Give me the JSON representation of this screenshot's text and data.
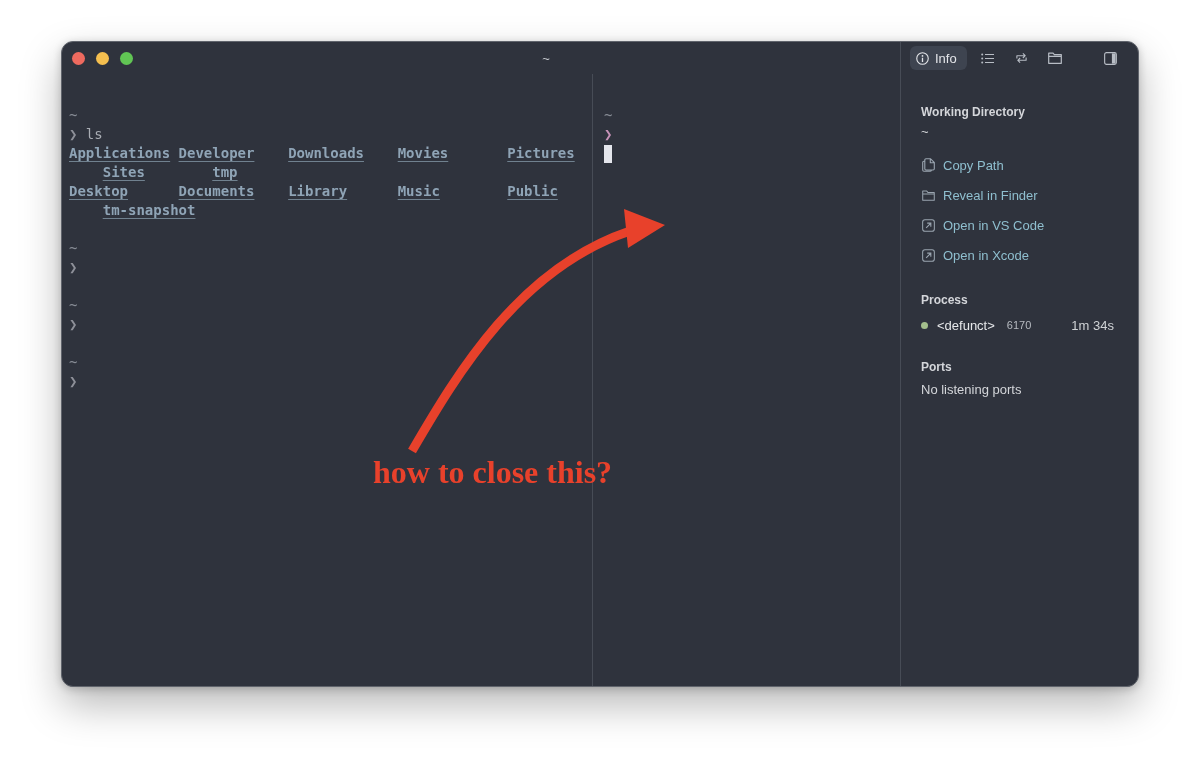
{
  "window": {
    "title": "~"
  },
  "terminal": {
    "panes": [
      {
        "focused": false,
        "blocks": [
          {
            "cwd": "~",
            "prompt": "❯",
            "command": "ls",
            "output": [
              {
                "continued": false,
                "entries": [
                  "Applications",
                  "Developer",
                  "Downloads",
                  "Movies",
                  "Pictures"
                ]
              },
              {
                "continued": true,
                "entries": [
                  "Sites",
                  "tmp"
                ]
              },
              {
                "continued": false,
                "entries": [
                  "Desktop",
                  "Documents",
                  "Library",
                  "Music",
                  "Public"
                ]
              },
              {
                "continued": true,
                "entries": [
                  "tm-snapshot"
                ]
              }
            ]
          },
          {
            "cwd": "~",
            "prompt": "❯"
          },
          {
            "cwd": "~",
            "prompt": "❯"
          },
          {
            "cwd": "~",
            "prompt": "❯"
          }
        ]
      },
      {
        "focused": true,
        "blocks": [
          {
            "cwd": "~",
            "prompt": "❯"
          }
        ]
      }
    ]
  },
  "sidebar": {
    "tabs": [
      {
        "kind": "info",
        "label": "Info",
        "selected": true
      },
      {
        "kind": "list",
        "selected": false
      },
      {
        "kind": "sync",
        "selected": false
      },
      {
        "kind": "folder",
        "selected": false
      }
    ],
    "working_directory": {
      "heading": "Working Directory",
      "path": "~",
      "actions": [
        {
          "kind": "copy",
          "label": "Copy Path"
        },
        {
          "kind": "reveal",
          "label": "Reveal in Finder"
        },
        {
          "kind": "open",
          "label": "Open in VS Code"
        },
        {
          "kind": "open",
          "label": "Open in Xcode"
        }
      ]
    },
    "process": {
      "heading": "Process",
      "items": [
        {
          "name": "<defunct>",
          "pid": "6170",
          "elapsed": "1m 34s",
          "color": "#a3be8c"
        }
      ]
    },
    "ports": {
      "heading": "Ports",
      "empty_text": "No listening ports"
    }
  },
  "annotation": {
    "text": "how to close this?"
  }
}
